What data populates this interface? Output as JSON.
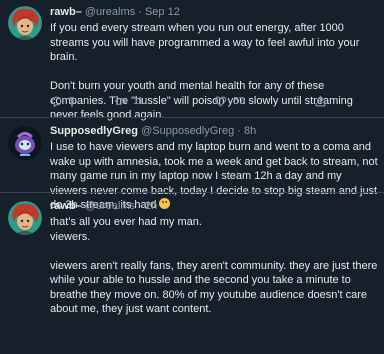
{
  "tweets": [
    {
      "name": "rawb–",
      "handle": "@urealms",
      "sep": "·",
      "time": "Sep 12",
      "paragraphs": [
        "If you end every stream when you run out energy, after 1000 streams you will have programmed a way to feel awful into your brain.",
        "Don't burn your youth and mental health for any of these companies. The \"hussle\" will poison you slowly until streaming never feels good again."
      ],
      "replies": "5",
      "retweets": "11",
      "likes": "57"
    },
    {
      "name": "SupposedlyGreg",
      "handle": "@SupposedlyGreg",
      "sep": "·",
      "time": "8h",
      "paragraphs": [
        "I use to have viewers and my laptop burn and went to a coma and wake up with amnesia, took me a week and get back to stream, not many game run in my laptop now I steam 12h a day and my viewers never come back, today I decide to stop big steam and just do 3h stream, its hard"
      ],
      "emoji": "slightly-frowning-face"
    },
    {
      "name": "rawb–",
      "handle": "@urealms",
      "sep": "·",
      "time": "2h",
      "paragraphs": [
        "that's all you ever had my man.",
        "viewers.",
        "",
        "viewers aren't really fans, they aren't community. they are just there while your able to hussle and the second you take a minute to breathe they move on. 80% of my youtube audience doesn't care about me, they just want content."
      ]
    }
  ],
  "icons": [
    "reply-icon",
    "retweet-icon",
    "like-icon",
    "share-icon"
  ],
  "colors": {
    "background": "#15202b",
    "text": "#e7e9ea",
    "muted": "#8b98a5",
    "divider": "#38444d"
  }
}
